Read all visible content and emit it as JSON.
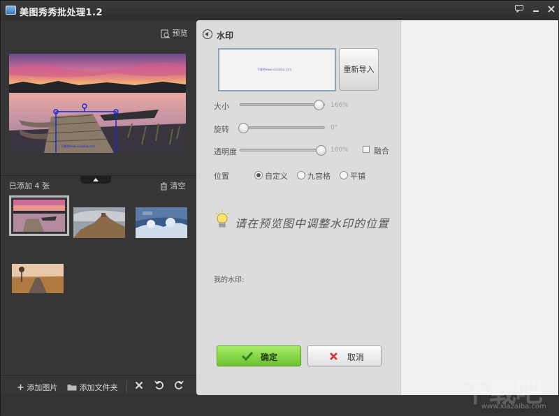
{
  "window": {
    "title": "美图秀秀批处理1.2",
    "buttons": [
      "feedback-icon",
      "minimize-icon",
      "close-icon"
    ]
  },
  "left_panel": {
    "preview_label": "预览",
    "added_count": "已添加 4 张",
    "clear_label": "清空",
    "thumbnails": [
      "lake-dock",
      "castle-cliff",
      "winter-sculptures",
      "road-sunset"
    ],
    "selected_thumbnail": 0,
    "toolbar": {
      "add_image": "添加图片",
      "add_folder": "添加文件夹"
    }
  },
  "watermark_panel": {
    "title": "水印",
    "preview_text": "下载吧www.xiazaiba.com",
    "reimport_label": "重新导入",
    "size_label": "大小",
    "size_value": "166%",
    "size_fraction": 0.97,
    "rotate_label": "旋转",
    "rotate_value": "0°",
    "rotate_fraction": 0.0,
    "opacity_label": "透明度",
    "opacity_value": "100%",
    "opacity_fraction": 1.0,
    "blend_label": "融合",
    "blend_checked": false,
    "position_label": "位置",
    "position_options": [
      "自定义",
      "九宫格",
      "平铺"
    ],
    "position_selected": "自定义",
    "hint": "请在预览图中调整水印的位置",
    "my_watermark_label": "我的水印:",
    "ok_label": "确定",
    "cancel_label": "取消"
  },
  "brand_watermark": {
    "main": "下载吧",
    "url": "www.xiazaiba.com"
  },
  "colors": {
    "ok_green": "#7ccf3e",
    "cancel_red": "#d83030",
    "dark_bg": "#363636",
    "panel_bg": "#dcdcdc"
  }
}
